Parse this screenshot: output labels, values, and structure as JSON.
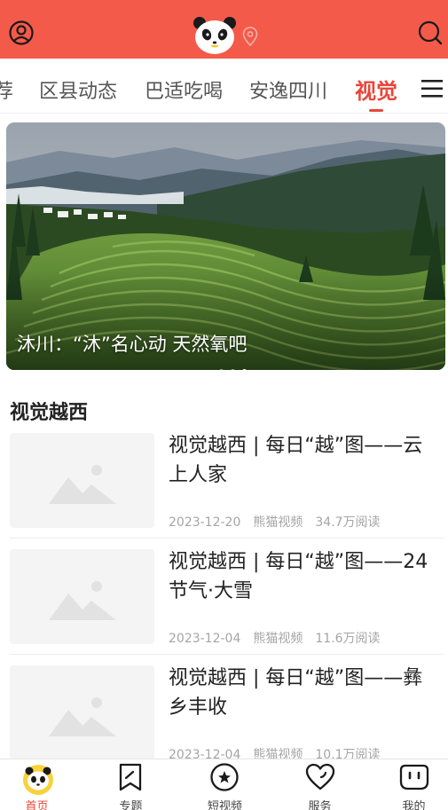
{
  "header": {
    "user_icon": "user-circle-icon",
    "logo": "panda-logo",
    "location_icon": "location-pin-icon",
    "search_icon": "search-icon",
    "brand_color": "#f45a4a"
  },
  "tabs": {
    "items": [
      {
        "label": "荐"
      },
      {
        "label": "区县动态"
      },
      {
        "label": "巴适吃喝"
      },
      {
        "label": "安逸四川"
      },
      {
        "label": "视觉"
      }
    ],
    "active_index": 4,
    "active_color": "#e8463a",
    "menu_icon": "hamburger-menu-icon"
  },
  "banner": {
    "caption": "沐川：“沐”名心动 天然氧吧",
    "slide_count": 3,
    "active_slide": 2
  },
  "section": {
    "title": "视觉越西"
  },
  "articles": [
    {
      "title": "视觉越西 | 每日“越”图——云上人家",
      "date": "2023-12-20",
      "source": "熊猫视频",
      "reads": "34.7万阅读"
    },
    {
      "title": "视觉越西 | 每日“越”图——24节气·大雪",
      "date": "2023-12-04",
      "source": "熊猫视频",
      "reads": "11.6万阅读"
    },
    {
      "title": "视觉越西 | 每日“越”图——彝乡丰收",
      "date": "2023-12-04",
      "source": "熊猫视频",
      "reads": "10.1万阅读"
    }
  ],
  "bottom_nav": {
    "items": [
      {
        "label": "首页",
        "icon": "panda-home-icon"
      },
      {
        "label": "专题",
        "icon": "bookmark-icon"
      },
      {
        "label": "短视频",
        "icon": "video-circle-icon"
      },
      {
        "label": "服务",
        "icon": "heart-icon"
      },
      {
        "label": "我的",
        "icon": "smile-face-icon"
      }
    ],
    "active_index": 0
  }
}
